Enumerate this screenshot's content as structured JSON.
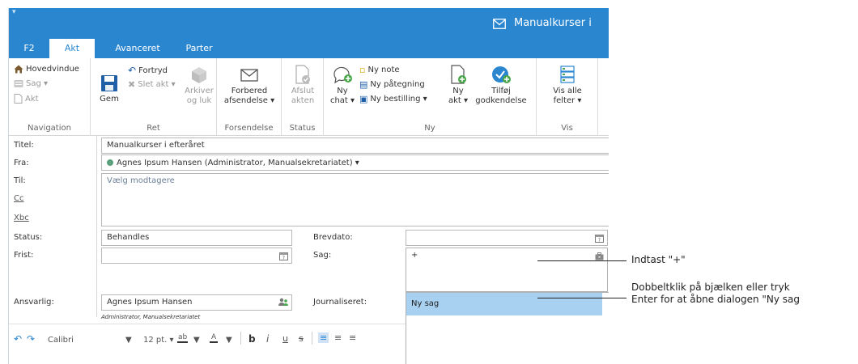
{
  "window": {
    "quick_access": "▾",
    "title": "Manualkurser i"
  },
  "tabs": [
    {
      "label": "F2"
    },
    {
      "label": "Akt",
      "active": true
    },
    {
      "label": "Avanceret"
    },
    {
      "label": "Parter"
    }
  ],
  "ribbon": {
    "navigation": {
      "title": "Navigation",
      "items": [
        "Hovedvindue",
        "Sag ▾",
        "Akt"
      ]
    },
    "ret": {
      "title": "Ret",
      "gem": "Gem",
      "fortryd": "Fortryd",
      "slet_akt": "Slet akt ▾",
      "arkiver_line1": "Arkiver",
      "arkiver_line2": "og luk"
    },
    "forsendelse": {
      "title": "Forsendelse",
      "line1": "Forbered",
      "line2": "afsendelse ▾"
    },
    "status": {
      "title": "Status",
      "line1": "Afslut",
      "line2": "akten"
    },
    "ny": {
      "title": "Ny",
      "chat_line1": "Ny",
      "chat_line2": "chat ▾",
      "ny_note": "Ny note",
      "ny_paategning": "Ny påtegning",
      "ny_bestilling": "Ny bestilling ▾",
      "akt_line1": "Ny",
      "akt_line2": "akt ▾",
      "tilfoej_line1": "Tilføj",
      "tilfoej_line2": "godkendelse"
    },
    "vis": {
      "title": "Vis",
      "line1": "Vis alle",
      "line2": "felter ▾"
    }
  },
  "form": {
    "titel_label": "Titel:",
    "titel_value": "Manualkurser i efteråret",
    "fra_label": "Fra:",
    "fra_value": "Agnes Ipsum Hansen (Administrator, Manualsekretariatet) ▾",
    "til_label": "Til:",
    "cc_label": "Cc",
    "xbc_label": "Xbc",
    "til_placeholder": "Vælg modtagere",
    "status_label": "Status:",
    "status_value": "Behandles",
    "frist_label": "Frist:",
    "brevdato_label": "Brevdato:",
    "sag_label": "Sag:",
    "sag_value": "+",
    "ansvarlig_label": "Ansvarlig:",
    "ansvarlig_value": "Agnes Ipsum Hansen",
    "ansvarlig_sub": "Administrator, Manualsekretariatet",
    "journaliseret_label": "Journaliseret:"
  },
  "dropdown": {
    "items": [
      "Ny sag"
    ]
  },
  "editor": {
    "font": "Calibri",
    "size": "12 pt. ▾",
    "bold": "b",
    "italic": "i",
    "underline": "u",
    "strike": "s"
  },
  "callouts": {
    "first": "Indtast \"+\"",
    "second_line1": "Dobbeltklik på bjælken eller tryk",
    "second_line2": "Enter for at åbne dialogen \"Ny sag"
  },
  "colors": {
    "accent": "#2b86d0",
    "selection": "#a8d0f0",
    "status_dot": "#5aa07c"
  }
}
